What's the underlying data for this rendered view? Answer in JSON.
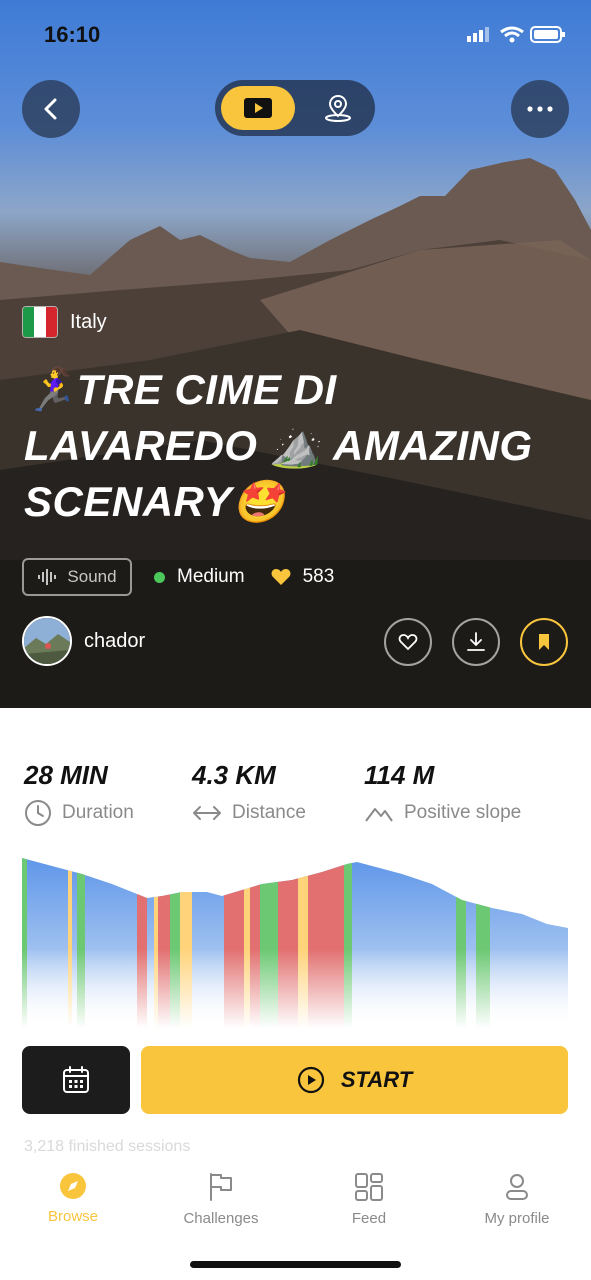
{
  "status_bar": {
    "time": "16:10"
  },
  "header": {
    "back_icon": "chevron-left-icon",
    "toggle": {
      "active": "video-play-icon",
      "inactive": "map-pin-icon"
    },
    "more_icon": "ellipsis-icon"
  },
  "hero": {
    "country": "Italy",
    "title_line1": "🏃‍♀️TRE CIME DI",
    "title_line2": "LAVAREDO ⛰️ AMAZING",
    "title_line3": "SCENARY🤩",
    "sound_label": "Sound",
    "difficulty": "Medium",
    "likes": "583",
    "author": "chador"
  },
  "stats": [
    {
      "value": "28 MIN",
      "label": "Duration",
      "icon": "clock-icon"
    },
    {
      "value": "4.3 KM",
      "label": "Distance",
      "icon": "arrows-horizontal-icon"
    },
    {
      "value": "114 M",
      "label": "Positive slope",
      "icon": "mountain-icon"
    }
  ],
  "actions": {
    "start_label": "START",
    "behind_text": "3,218 finished sessions"
  },
  "tabs": [
    {
      "label": "Browse",
      "icon": "compass-icon"
    },
    {
      "label": "Challenges",
      "icon": "flag-icon"
    },
    {
      "label": "Feed",
      "icon": "grid-icon"
    },
    {
      "label": "My profile",
      "icon": "person-icon"
    }
  ],
  "colors": {
    "accent": "#f9c53d",
    "difficulty_dot": "#4cc85a",
    "dark_button": "#1c1c1c"
  }
}
